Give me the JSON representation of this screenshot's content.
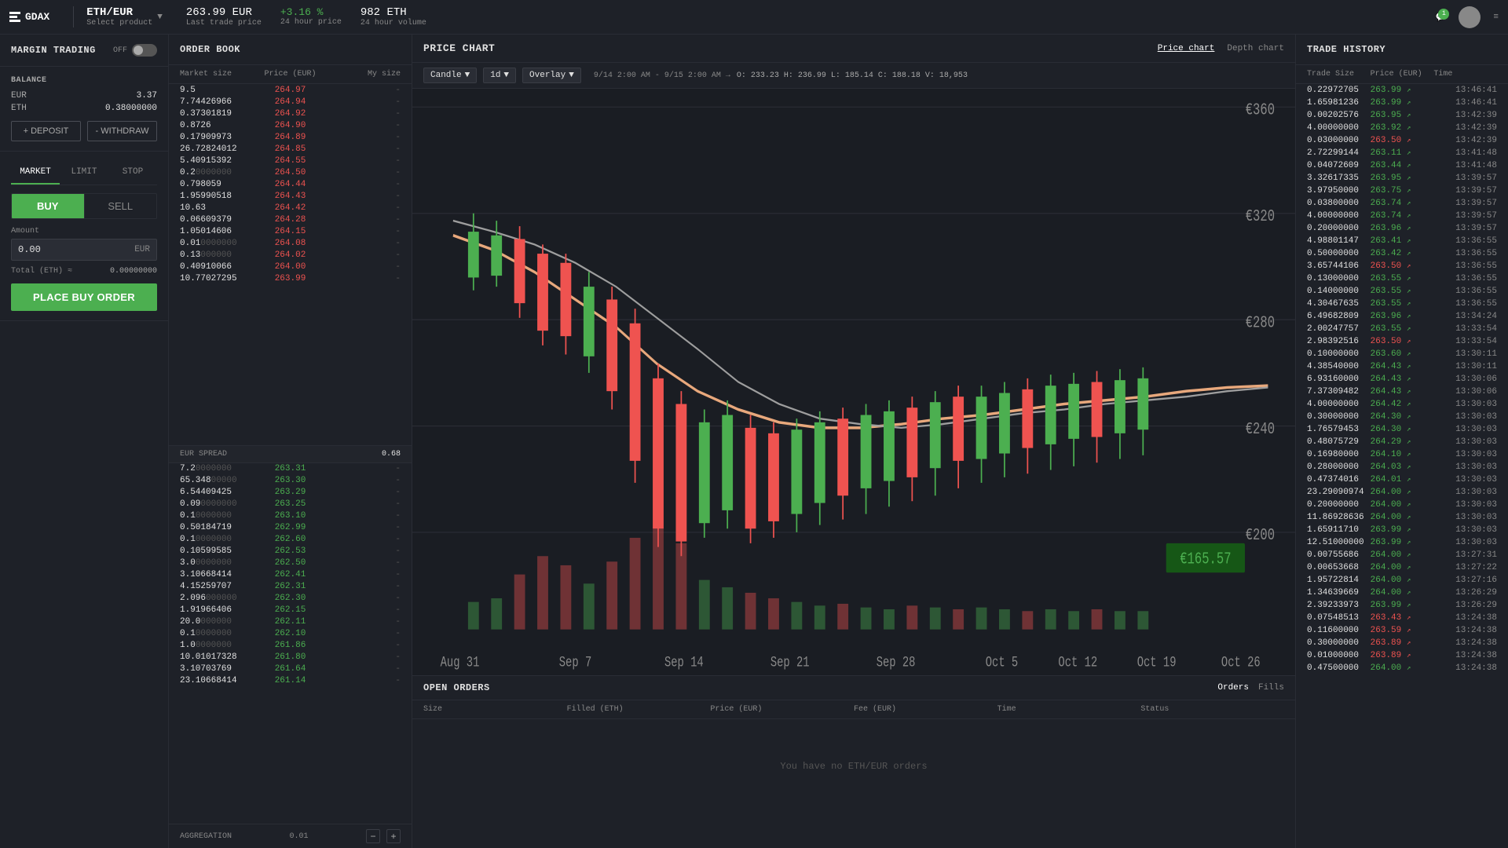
{
  "header": {
    "logo": "GDAX",
    "product": "ETH/EUR",
    "product_sub": "Select product",
    "last_price": "263.99 EUR",
    "last_label": "Last trade price",
    "change": "+3.16 %",
    "change_label": "24 hour price",
    "volume": "982 ETH",
    "volume_label": "24 hour volume",
    "notif_count": "1"
  },
  "left_panel": {
    "margin_title": "MARGIN TRADING",
    "toggle_label": "OFF",
    "balance_title": "BALANCE",
    "eur_label": "EUR",
    "eur_amount": "3.37",
    "eth_label": "ETH",
    "eth_amount": "0.38000000",
    "deposit_label": "+ DEPOSIT",
    "withdraw_label": "- WITHDRAW",
    "tab_market": "MARKET",
    "tab_limit": "LIMIT",
    "tab_stop": "STOP",
    "btn_buy": "BUY",
    "btn_sell": "SELL",
    "amount_label": "Amount",
    "amount_placeholder": "0.00",
    "amount_currency": "EUR",
    "total_label": "Total (ETH) ≈",
    "total_value": "0.00000000",
    "place_order_btn": "PLACE BUY ORDER"
  },
  "orderbook": {
    "title": "ORDER BOOK",
    "col_market": "Market size",
    "col_price": "Price (EUR)",
    "col_mysize": "My size",
    "asks": [
      {
        "qty": "9.5",
        "qty_dim": "",
        "price": "264.97",
        "mysize": "-"
      },
      {
        "qty": "7.74426966",
        "qty_dim": "",
        "price": "264.94",
        "mysize": "-"
      },
      {
        "qty": "0.37301819",
        "qty_dim": "",
        "price": "264.92",
        "mysize": "-"
      },
      {
        "qty": "0.8726",
        "qty_dim": "",
        "price": "264.90",
        "mysize": "-"
      },
      {
        "qty": "0.17909973",
        "qty_dim": "",
        "price": "264.89",
        "mysize": "-"
      },
      {
        "qty": "26.72824012",
        "qty_dim": "",
        "price": "264.85",
        "mysize": "-"
      },
      {
        "qty": "5.40915392",
        "qty_dim": "",
        "price": "264.55",
        "mysize": "-"
      },
      {
        "qty": "0.2",
        "qty_dim": "0000000",
        "price": "264.50",
        "mysize": "-"
      },
      {
        "qty": "0.798059",
        "qty_dim": "",
        "price": "264.44",
        "mysize": "-"
      },
      {
        "qty": "1.95990518",
        "qty_dim": "",
        "price": "264.43",
        "mysize": "-"
      },
      {
        "qty": "10.63",
        "qty_dim": "",
        "price": "264.42",
        "mysize": "-"
      },
      {
        "qty": "0.06609379",
        "qty_dim": "",
        "price": "264.28",
        "mysize": "-"
      },
      {
        "qty": "1.05014606",
        "qty_dim": "",
        "price": "264.15",
        "mysize": "-"
      },
      {
        "qty": "0.01",
        "qty_dim": "0000000",
        "price": "264.08",
        "mysize": "-"
      },
      {
        "qty": "0.13",
        "qty_dim": "000000",
        "price": "264.02",
        "mysize": "-"
      },
      {
        "qty": "0.40910066",
        "qty_dim": "",
        "price": "264.00",
        "mysize": "-"
      },
      {
        "qty": "10.77027295",
        "qty_dim": "",
        "price": "263.99",
        "mysize": "-"
      }
    ],
    "spread_label": "EUR SPREAD",
    "spread_value": "0.68",
    "bids": [
      {
        "qty": "7.2",
        "qty_dim": "0000000",
        "price": "263.31",
        "mysize": "-"
      },
      {
        "qty": "65.348",
        "qty_dim": "00000",
        "price": "263.30",
        "mysize": "-"
      },
      {
        "qty": "6.54409425",
        "qty_dim": "",
        "price": "263.29",
        "mysize": "-"
      },
      {
        "qty": "0.09",
        "qty_dim": "0000000",
        "price": "263.25",
        "mysize": "-"
      },
      {
        "qty": "0.1",
        "qty_dim": "0000000",
        "price": "263.10",
        "mysize": "-"
      },
      {
        "qty": "0.50184719",
        "qty_dim": "",
        "price": "262.99",
        "mysize": "-"
      },
      {
        "qty": "0.1",
        "qty_dim": "0000000",
        "price": "262.60",
        "mysize": "-"
      },
      {
        "qty": "0.10599585",
        "qty_dim": "",
        "price": "262.53",
        "mysize": "-"
      },
      {
        "qty": "3.0",
        "qty_dim": "0000000",
        "price": "262.50",
        "mysize": "-"
      },
      {
        "qty": "3.10668414",
        "qty_dim": "",
        "price": "262.41",
        "mysize": "-"
      },
      {
        "qty": "4.15259707",
        "qty_dim": "",
        "price": "262.31",
        "mysize": "-"
      },
      {
        "qty": "2.096",
        "qty_dim": "000000",
        "price": "262.30",
        "mysize": "-"
      },
      {
        "qty": "1.91966406",
        "qty_dim": "",
        "price": "262.15",
        "mysize": "-"
      },
      {
        "qty": "20.0",
        "qty_dim": "000000",
        "price": "262.11",
        "mysize": "-"
      },
      {
        "qty": "0.1",
        "qty_dim": "0000000",
        "price": "262.10",
        "mysize": "-"
      },
      {
        "qty": "1.0",
        "qty_dim": "0000000",
        "price": "261.86",
        "mysize": "-"
      },
      {
        "qty": "10.01017328",
        "qty_dim": "",
        "price": "261.80",
        "mysize": "-"
      },
      {
        "qty": "3.10703769",
        "qty_dim": "",
        "price": "261.64",
        "mysize": "-"
      },
      {
        "qty": "23.10668414",
        "qty_dim": "",
        "price": "261.14",
        "mysize": "-"
      }
    ],
    "agg_label": "AGGREGATION",
    "agg_value": "0.01"
  },
  "chart": {
    "title": "PRICE CHART",
    "tab_price": "Price chart",
    "tab_depth": "Depth chart",
    "candle_label": "Candle",
    "interval_label": "1d",
    "overlay_label": "Overlay",
    "range": "9/14 2:00 AM - 9/15 2:00 AM →",
    "ohlcv": "O: 233.23  H: 236.99  L: 185.14  C: 188.18  V: 18,953",
    "price_high": "€360",
    "price_mid1": "€320",
    "price_mid2": "€280",
    "price_mid3": "€240",
    "price_mid4": "€200",
    "price_last": "€165.57",
    "labels": [
      "Aug 31",
      "Sep 7",
      "Sep 14",
      "Sep 21",
      "Sep 28",
      "Oct 5",
      "Oct 12",
      "Oct 19",
      "Oct 26"
    ]
  },
  "open_orders": {
    "title": "OPEN ORDERS",
    "tab_orders": "Orders",
    "tab_fills": "Fills",
    "col_size": "Size",
    "col_filled": "Filled (ETH)",
    "col_price": "Price (EUR)",
    "col_fee": "Fee (EUR)",
    "col_time": "Time",
    "col_status": "Status",
    "empty_msg": "You have no ETH/EUR orders"
  },
  "trade_history": {
    "title": "TRADE HISTORY",
    "col_size": "Trade Size",
    "col_price": "Price (EUR)",
    "col_time": "Time",
    "trades": [
      {
        "size": "0.22972705",
        "price": "263.99",
        "dir": "up",
        "time": "13:46:41"
      },
      {
        "size": "1.65981236",
        "price": "263.99",
        "dir": "up",
        "time": "13:46:41"
      },
      {
        "size": "0.00202576",
        "price": "263.95",
        "dir": "up",
        "time": "13:42:39"
      },
      {
        "size": "4.00000000",
        "price": "263.92",
        "dir": "up",
        "time": "13:42:39"
      },
      {
        "size": "0.03000000",
        "price": "263.50",
        "dir": "down",
        "time": "13:42:39"
      },
      {
        "size": "2.72299144",
        "price": "263.11",
        "dir": "up",
        "time": "13:41:48"
      },
      {
        "size": "0.04072609",
        "price": "263.44",
        "dir": "up",
        "time": "13:41:48"
      },
      {
        "size": "3.32617335",
        "price": "263.95",
        "dir": "up",
        "time": "13:39:57"
      },
      {
        "size": "3.97950000",
        "price": "263.75",
        "dir": "up",
        "time": "13:39:57"
      },
      {
        "size": "0.03800000",
        "price": "263.74",
        "dir": "up",
        "time": "13:39:57"
      },
      {
        "size": "4.00000000",
        "price": "263.74",
        "dir": "up",
        "time": "13:39:57"
      },
      {
        "size": "0.20000000",
        "price": "263.96",
        "dir": "up",
        "time": "13:39:57"
      },
      {
        "size": "4.98801147",
        "price": "263.41",
        "dir": "up",
        "time": "13:36:55"
      },
      {
        "size": "0.50000000",
        "price": "263.42",
        "dir": "up",
        "time": "13:36:55"
      },
      {
        "size": "3.65744106",
        "price": "263.50",
        "dir": "down",
        "time": "13:36:55"
      },
      {
        "size": "0.13000000",
        "price": "263.55",
        "dir": "up",
        "time": "13:36:55"
      },
      {
        "size": "0.14000000",
        "price": "263.55",
        "dir": "up",
        "time": "13:36:55"
      },
      {
        "size": "4.30467635",
        "price": "263.55",
        "dir": "up",
        "time": "13:36:55"
      },
      {
        "size": "6.49682809",
        "price": "263.96",
        "dir": "up",
        "time": "13:34:24"
      },
      {
        "size": "2.00247757",
        "price": "263.55",
        "dir": "up",
        "time": "13:33:54"
      },
      {
        "size": "2.98392516",
        "price": "263.50",
        "dir": "down",
        "time": "13:33:54"
      },
      {
        "size": "0.10000000",
        "price": "263.60",
        "dir": "up",
        "time": "13:30:11"
      },
      {
        "size": "4.38540000",
        "price": "264.43",
        "dir": "up",
        "time": "13:30:11"
      },
      {
        "size": "6.93160000",
        "price": "264.43",
        "dir": "up",
        "time": "13:30:06"
      },
      {
        "size": "7.37309482",
        "price": "264.43",
        "dir": "up",
        "time": "13:30:06"
      },
      {
        "size": "4.00000000",
        "price": "264.42",
        "dir": "up",
        "time": "13:30:03"
      },
      {
        "size": "0.30000000",
        "price": "264.30",
        "dir": "up",
        "time": "13:30:03"
      },
      {
        "size": "1.76579453",
        "price": "264.30",
        "dir": "up",
        "time": "13:30:03"
      },
      {
        "size": "0.48075729",
        "price": "264.29",
        "dir": "up",
        "time": "13:30:03"
      },
      {
        "size": "0.16980000",
        "price": "264.10",
        "dir": "up",
        "time": "13:30:03"
      },
      {
        "size": "0.28000000",
        "price": "264.03",
        "dir": "up",
        "time": "13:30:03"
      },
      {
        "size": "0.47374016",
        "price": "264.01",
        "dir": "up",
        "time": "13:30:03"
      },
      {
        "size": "23.29090974",
        "price": "264.00",
        "dir": "up",
        "time": "13:30:03"
      },
      {
        "size": "0.20000000",
        "price": "264.00",
        "dir": "up",
        "time": "13:30:03"
      },
      {
        "size": "11.86928636",
        "price": "264.00",
        "dir": "up",
        "time": "13:30:03"
      },
      {
        "size": "1.65911710",
        "price": "263.99",
        "dir": "up",
        "time": "13:30:03"
      },
      {
        "size": "12.51000000",
        "price": "263.99",
        "dir": "up",
        "time": "13:30:03"
      },
      {
        "size": "0.00755686",
        "price": "264.00",
        "dir": "up",
        "time": "13:27:31"
      },
      {
        "size": "0.00653668",
        "price": "264.00",
        "dir": "up",
        "time": "13:27:22"
      },
      {
        "size": "1.95722814",
        "price": "264.00",
        "dir": "up",
        "time": "13:27:16"
      },
      {
        "size": "1.34639669",
        "price": "264.00",
        "dir": "up",
        "time": "13:26:29"
      },
      {
        "size": "2.39233973",
        "price": "263.99",
        "dir": "up",
        "time": "13:26:29"
      },
      {
        "size": "0.07548513",
        "price": "263.43",
        "dir": "down",
        "time": "13:24:38"
      },
      {
        "size": "0.11600000",
        "price": "263.59",
        "dir": "down",
        "time": "13:24:38"
      },
      {
        "size": "0.30000000",
        "price": "263.89",
        "dir": "down",
        "time": "13:24:38"
      },
      {
        "size": "0.01000000",
        "price": "263.89",
        "dir": "down",
        "time": "13:24:38"
      },
      {
        "size": "0.47500000",
        "price": "264.00",
        "dir": "up",
        "time": "13:24:38"
      }
    ]
  }
}
